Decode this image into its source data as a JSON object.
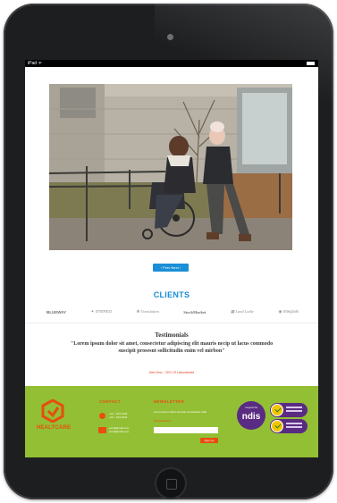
{
  "device": {
    "status_carrier": "iPad ᯤ"
  },
  "hero": {
    "pager_label": "‹  Prev  Next  ›"
  },
  "clients": {
    "title": "CLIENTS",
    "logos": [
      "BLUEWAY",
      "✦ STEREO",
      "❋ Translation",
      "StockMarket",
      "▦ Land Ladie",
      "◉ Integrals"
    ]
  },
  "testimonial": {
    "title": "Testimonials",
    "quote": "\"Lorem ipsum dolor sit amet, consectetur adipiscing elit mauris necip ut lacus commodo suscipit prosesnt sollicitudin enim vel mirbon\"",
    "author": "Alex Dew - CEO Of Laboratories"
  },
  "footer": {
    "brand_name": "HEALTCARE",
    "contact_heading": "CONTACT",
    "phone_lines": [
      "+44 - 444 4444",
      "+44 - 444 4444"
    ],
    "email_lines": [
      "email@mail.com",
      "email@mail.com"
    ],
    "newsletter_heading": "NEWSLETTER",
    "newsletter_text": "Lorem ipsum dolor sit amet consectetur adip",
    "newsletter_label": "Email Address",
    "signup_label": "Sign Up",
    "ndis_small": "I support the",
    "ndis_big": "ndis"
  },
  "colors": {
    "accent_blue": "#1a8fd6",
    "brand_orange": "#e84d0e",
    "footer_green": "#93bf34",
    "ndis_purple": "#5a2b82"
  },
  "icons": {
    "phone": "phone-icon",
    "mail": "mail-icon",
    "camera": "camera-icon",
    "home": "home-button-icon"
  }
}
